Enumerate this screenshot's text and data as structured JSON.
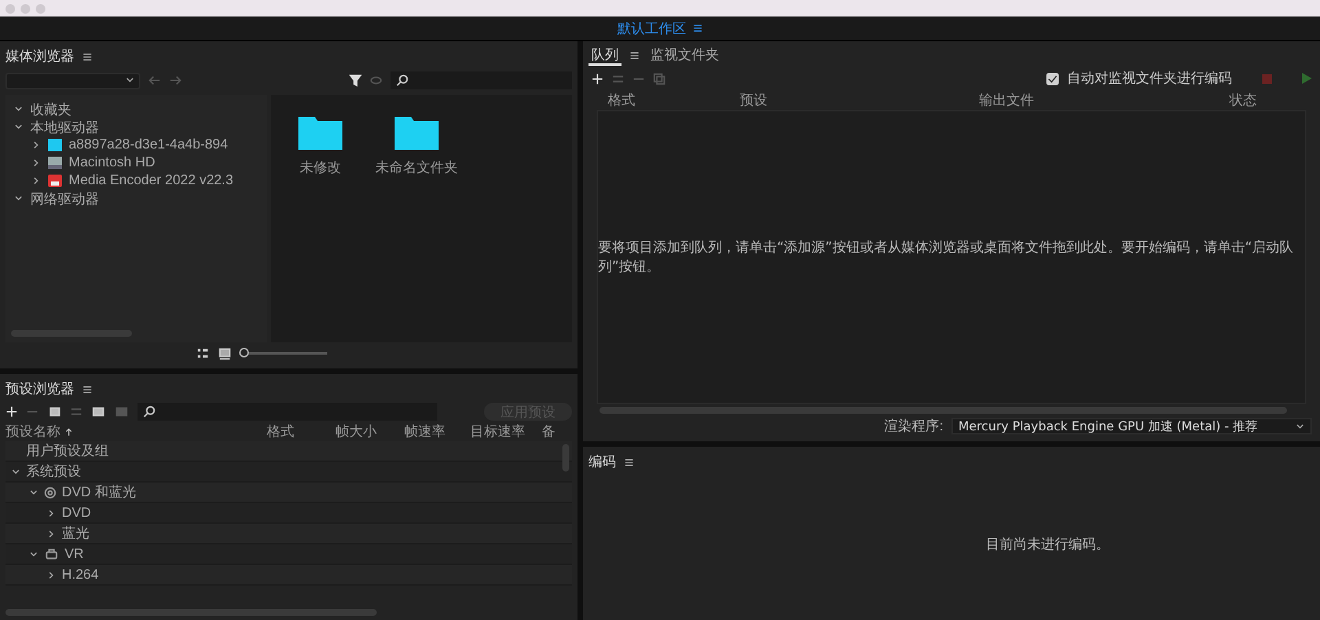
{
  "workspace": {
    "title": "默认工作区"
  },
  "media_browser": {
    "title": "媒体浏览器",
    "tree": [
      {
        "label": "收藏夹",
        "expanded": true
      },
      {
        "label": "本地驱动器",
        "expanded": true,
        "children": [
          {
            "label": "a8897a28-d3e1-4a4b-894",
            "kind": "volume",
            "expanded": false
          },
          {
            "label": "Macintosh HD",
            "kind": "disk",
            "expanded": false
          },
          {
            "label": "Media Encoder 2022 v22.3",
            "kind": "app",
            "expanded": false
          }
        ]
      },
      {
        "label": "网络驱动器",
        "expanded": true
      }
    ],
    "folders": [
      "未修改",
      "未命名文件夹"
    ],
    "zoom": {
      "level": 0.05
    }
  },
  "preset_browser": {
    "title": "预设浏览器",
    "apply_button": "应用预设",
    "columns": [
      "预设名称",
      "格式",
      "帧大小",
      "帧速率",
      "目标速率",
      "备"
    ],
    "rows": [
      {
        "label": "用户预设及组"
      },
      {
        "label": "系统预设",
        "expanded": true,
        "children": [
          {
            "label": "DVD 和蓝光",
            "kind": "disc",
            "expanded": true,
            "children": [
              {
                "label": "DVD",
                "expanded": false
              },
              {
                "label": "蓝光",
                "expanded": false
              }
            ]
          },
          {
            "label": "VR",
            "kind": "vr",
            "expanded": true,
            "children": [
              {
                "label": "H.264",
                "expanded": false
              }
            ]
          }
        ]
      }
    ]
  },
  "queue": {
    "tabs": [
      {
        "label": "队列",
        "selected": true
      },
      {
        "label": "监视文件夹",
        "selected": false
      }
    ],
    "auto_encode": {
      "label": "自动对监视文件夹进行编码",
      "checked": true
    },
    "columns": [
      "格式",
      "预设",
      "输出文件",
      "状态"
    ],
    "empty_message": "要将项目添加到队列，请单击“添加源”按钮或者从媒体浏览器或桌面将文件拖到此处。要开始编码，请单击“启动队列”按钮。",
    "renderer": {
      "label": "渲染程序:",
      "value": "Mercury Playback Engine GPU 加速 (Metal) - 推荐"
    }
  },
  "encoding": {
    "title": "编码",
    "message": "目前尚未进行编码。"
  }
}
